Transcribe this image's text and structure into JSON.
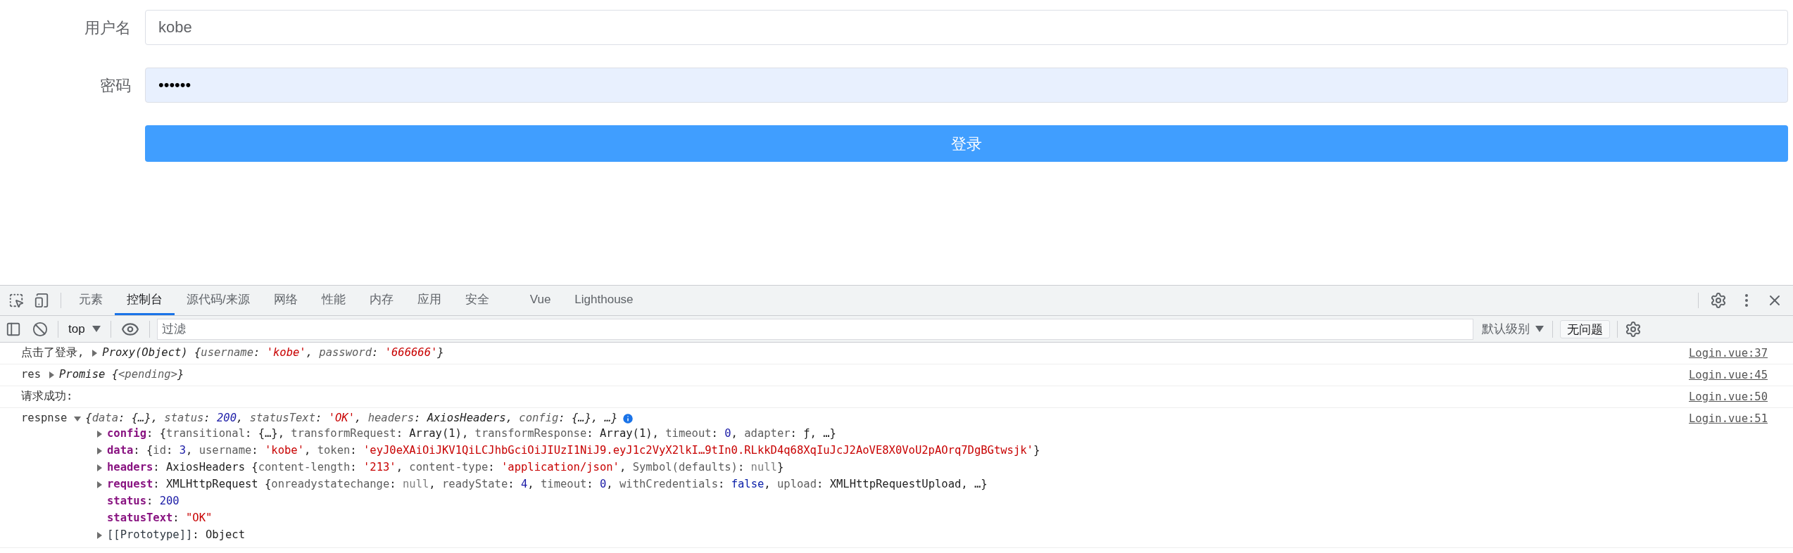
{
  "form": {
    "fields": [
      {
        "label": "用户名",
        "kind": "text",
        "value": "kobe",
        "autofilled": false
      },
      {
        "label": "密码",
        "kind": "password",
        "value": "••••••",
        "autofilled": true
      }
    ],
    "submit": "登录"
  },
  "devtools": {
    "tabs": [
      {
        "label": "元素",
        "selected": false
      },
      {
        "label": "控制台",
        "selected": true
      },
      {
        "label": "源代码/来源",
        "selected": false
      },
      {
        "label": "网络",
        "selected": false
      },
      {
        "label": "性能",
        "selected": false
      },
      {
        "label": "内存",
        "selected": false
      },
      {
        "label": "应用",
        "selected": false
      },
      {
        "label": "安全",
        "selected": false
      },
      {
        "label": "Vue",
        "selected": false
      },
      {
        "label": "Lighthouse",
        "selected": false
      }
    ],
    "toolbar": {
      "context": "top",
      "filter": {
        "placeholder": "过滤"
      },
      "level": "默认级别",
      "issues": "无问题"
    },
    "console": [
      {
        "label": "点击了登录,",
        "expanded": false,
        "summary": [
          {
            "text": "Proxy(Object) {",
            "kind": "plain"
          },
          {
            "text": "username",
            "kind": "name"
          },
          {
            "text": ": ",
            "kind": "plain"
          },
          {
            "text": "'kobe'",
            "kind": "string"
          },
          {
            "text": ", ",
            "kind": "plain"
          },
          {
            "text": "password",
            "kind": "name"
          },
          {
            "text": ": ",
            "kind": "plain"
          },
          {
            "text": "'666666'",
            "kind": "string"
          },
          {
            "text": "}",
            "kind": "plain"
          }
        ],
        "source": "Login.vue:37"
      },
      {
        "label": "res",
        "expanded": false,
        "summary": [
          {
            "text": "Promise {",
            "kind": "plain"
          },
          {
            "text": "<pending>",
            "kind": "name"
          },
          {
            "text": "}",
            "kind": "plain"
          }
        ],
        "source": "Login.vue:45"
      },
      {
        "label": "请求成功:",
        "source": "Login.vue:50"
      },
      {
        "label": "respnse",
        "expanded": true,
        "summary": [
          {
            "text": "{",
            "kind": "plain"
          },
          {
            "text": "data",
            "kind": "name"
          },
          {
            "text": ": {…}, ",
            "kind": "plain"
          },
          {
            "text": "status",
            "kind": "name"
          },
          {
            "text": ": ",
            "kind": "plain"
          },
          {
            "text": "200",
            "kind": "number"
          },
          {
            "text": ", ",
            "kind": "plain"
          },
          {
            "text": "statusText",
            "kind": "name"
          },
          {
            "text": ": ",
            "kind": "plain"
          },
          {
            "text": "'OK'",
            "kind": "string"
          },
          {
            "text": ", ",
            "kind": "plain"
          },
          {
            "text": "headers",
            "kind": "name"
          },
          {
            "text": ": AxiosHeaders, ",
            "kind": "plain"
          },
          {
            "text": "config",
            "kind": "name"
          },
          {
            "text": ": {…}, …}",
            "kind": "plain"
          }
        ],
        "source": "Login.vue:51",
        "info": true,
        "children": [
          {
            "key": "config",
            "own": true,
            "expandable": true,
            "value": [
              {
                "text": ": {",
                "kind": "plain"
              },
              {
                "text": "transitional",
                "kind": "name"
              },
              {
                "text": ": {…}, ",
                "kind": "plain"
              },
              {
                "text": "transformRequest",
                "kind": "name"
              },
              {
                "text": ": Array(1), ",
                "kind": "plain"
              },
              {
                "text": "transformResponse",
                "kind": "name"
              },
              {
                "text": ": Array(1), ",
                "kind": "plain"
              },
              {
                "text": "timeout",
                "kind": "name"
              },
              {
                "text": ": ",
                "kind": "plain"
              },
              {
                "text": "0",
                "kind": "number"
              },
              {
                "text": ", ",
                "kind": "plain"
              },
              {
                "text": "adapter",
                "kind": "name"
              },
              {
                "text": ": ƒ, …}",
                "kind": "plain"
              }
            ]
          },
          {
            "key": "data",
            "own": true,
            "expandable": true,
            "value": [
              {
                "text": ": {",
                "kind": "plain"
              },
              {
                "text": "id",
                "kind": "name"
              },
              {
                "text": ": ",
                "kind": "plain"
              },
              {
                "text": "3",
                "kind": "number"
              },
              {
                "text": ", ",
                "kind": "plain"
              },
              {
                "text": "username",
                "kind": "name"
              },
              {
                "text": ": ",
                "kind": "plain"
              },
              {
                "text": "'kobe'",
                "kind": "string"
              },
              {
                "text": ", ",
                "kind": "plain"
              },
              {
                "text": "token",
                "kind": "name"
              },
              {
                "text": ": ",
                "kind": "plain"
              },
              {
                "text": "'eyJ0eXAiOiJKV1QiLCJhbGciOiJIUzI1NiJ9.eyJ1c2VyX2lkI…9tIn0.RLkkD4q68XqIuJcJ2AoVE8X0VoU2pAOrq7DgBGtwsjk'",
                "kind": "string"
              },
              {
                "text": "}",
                "kind": "plain"
              }
            ]
          },
          {
            "key": "headers",
            "own": true,
            "expandable": true,
            "value": [
              {
                "text": ": AxiosHeaders {",
                "kind": "plain"
              },
              {
                "text": "content-length",
                "kind": "name"
              },
              {
                "text": ": ",
                "kind": "plain"
              },
              {
                "text": "'213'",
                "kind": "string"
              },
              {
                "text": ", ",
                "kind": "plain"
              },
              {
                "text": "content-type",
                "kind": "name"
              },
              {
                "text": ": ",
                "kind": "plain"
              },
              {
                "text": "'application/json'",
                "kind": "string"
              },
              {
                "text": ", ",
                "kind": "plain"
              },
              {
                "text": "Symbol(defaults)",
                "kind": "name"
              },
              {
                "text": ": ",
                "kind": "plain"
              },
              {
                "text": "null",
                "kind": "null"
              },
              {
                "text": "}",
                "kind": "plain"
              }
            ]
          },
          {
            "key": "request",
            "own": true,
            "expandable": true,
            "value": [
              {
                "text": ": XMLHttpRequest {",
                "kind": "plain"
              },
              {
                "text": "onreadystatechange",
                "kind": "name"
              },
              {
                "text": ": ",
                "kind": "plain"
              },
              {
                "text": "null",
                "kind": "null"
              },
              {
                "text": ", ",
                "kind": "plain"
              },
              {
                "text": "readyState",
                "kind": "name"
              },
              {
                "text": ": ",
                "kind": "plain"
              },
              {
                "text": "4",
                "kind": "number"
              },
              {
                "text": ", ",
                "kind": "plain"
              },
              {
                "text": "timeout",
                "kind": "name"
              },
              {
                "text": ": ",
                "kind": "plain"
              },
              {
                "text": "0",
                "kind": "number"
              },
              {
                "text": ", ",
                "kind": "plain"
              },
              {
                "text": "withCredentials",
                "kind": "name"
              },
              {
                "text": ": ",
                "kind": "plain"
              },
              {
                "text": "false",
                "kind": "keyword"
              },
              {
                "text": ", ",
                "kind": "plain"
              },
              {
                "text": "upload",
                "kind": "name"
              },
              {
                "text": ": XMLHttpRequestUpload, …}",
                "kind": "plain"
              }
            ]
          },
          {
            "key": "status",
            "own": true,
            "expandable": false,
            "value": [
              {
                "text": ": ",
                "kind": "plain"
              },
              {
                "text": "200",
                "kind": "number"
              }
            ]
          },
          {
            "key": "statusText",
            "own": true,
            "expandable": false,
            "value": [
              {
                "text": ": ",
                "kind": "plain"
              },
              {
                "text": "\"OK\"",
                "kind": "string"
              }
            ]
          },
          {
            "key": "[[Prototype]]",
            "own": false,
            "expandable": true,
            "value": [
              {
                "text": ": Object",
                "kind": "plain"
              }
            ]
          }
        ]
      }
    ]
  }
}
